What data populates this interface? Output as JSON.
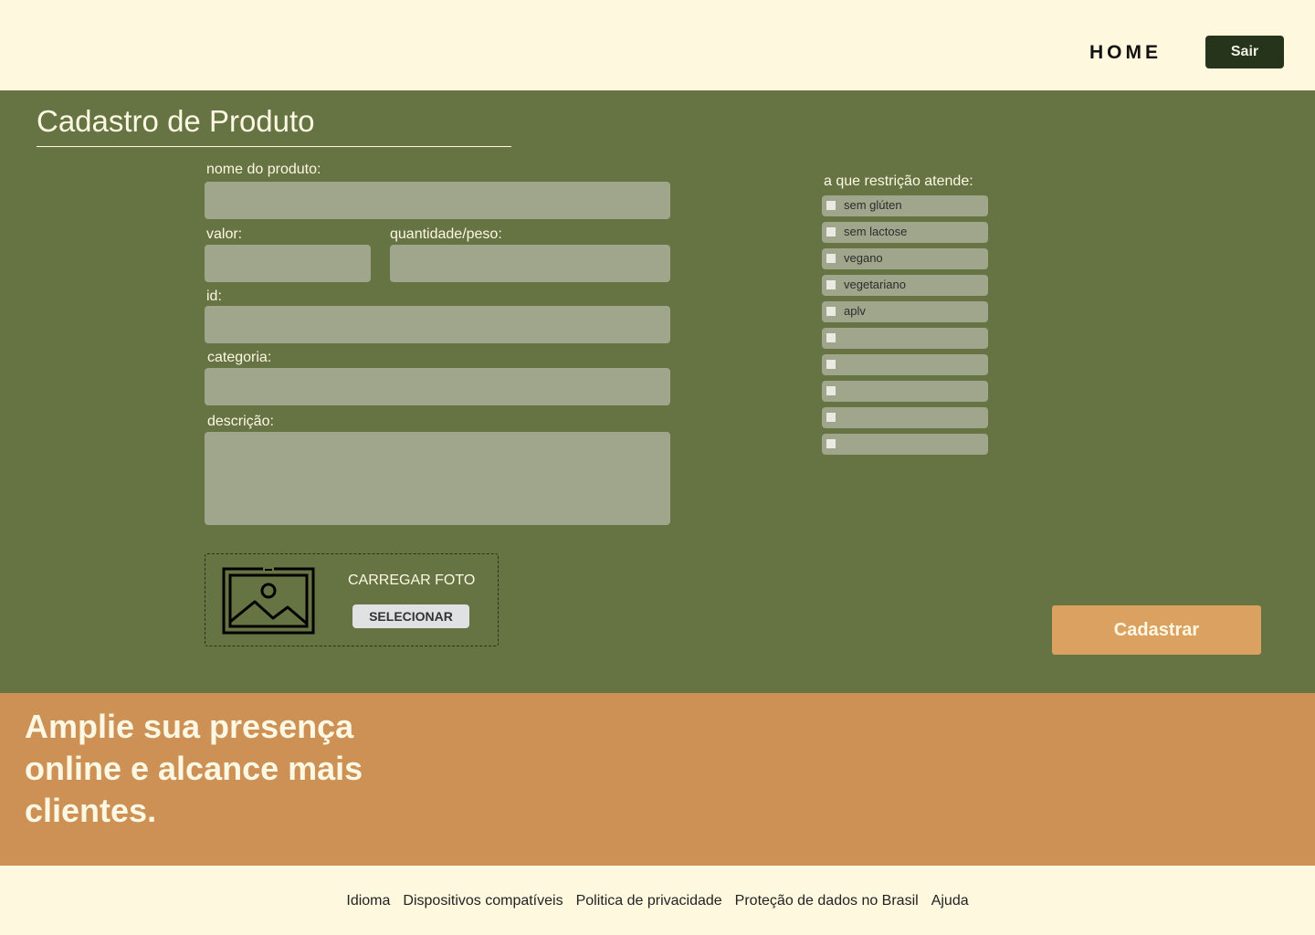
{
  "header": {
    "home_label": "HOME",
    "logout_label": "Sair"
  },
  "form": {
    "title": "Cadastro de Produto",
    "product_name_label": "nome do produto:",
    "product_name_value": "",
    "value_label": "valor:",
    "value_value": "",
    "quantity_label": "quantidade/peso:",
    "quantity_value": "",
    "id_label": "id:",
    "id_value": "",
    "category_label": "categoria:",
    "category_value": "",
    "description_label": "descrição:",
    "description_value": "",
    "upload": {
      "title": "CARREGAR FOTO",
      "select_label": "SELECIONAR",
      "icon": "image-icon"
    },
    "submit_label": "Cadastrar"
  },
  "restrictions": {
    "title": "a que restrição atende:",
    "items": [
      {
        "label": "sem glúten",
        "checked": false
      },
      {
        "label": "sem lactose",
        "checked": false
      },
      {
        "label": "vegano",
        "checked": false
      },
      {
        "label": "vegetariano",
        "checked": false
      },
      {
        "label": "aplv",
        "checked": false
      },
      {
        "label": "",
        "checked": false
      },
      {
        "label": "",
        "checked": false
      },
      {
        "label": "",
        "checked": false
      },
      {
        "label": "",
        "checked": false
      },
      {
        "label": "",
        "checked": false
      }
    ]
  },
  "banner": {
    "text": "Amplie sua presença online e alcance mais clientes."
  },
  "footer": {
    "links": [
      "Idioma",
      "Dispositivos compatíveis",
      "Politica de privacidade",
      "Proteção de dados no Brasil",
      "Ajuda"
    ]
  },
  "colors": {
    "background_cream": "#fef8df",
    "main_green": "#667342",
    "field_gray_green": "#9fa68b",
    "dark_green_button": "#25341a",
    "submit_orange": "#dba160",
    "banner_orange": "#cd9055"
  }
}
